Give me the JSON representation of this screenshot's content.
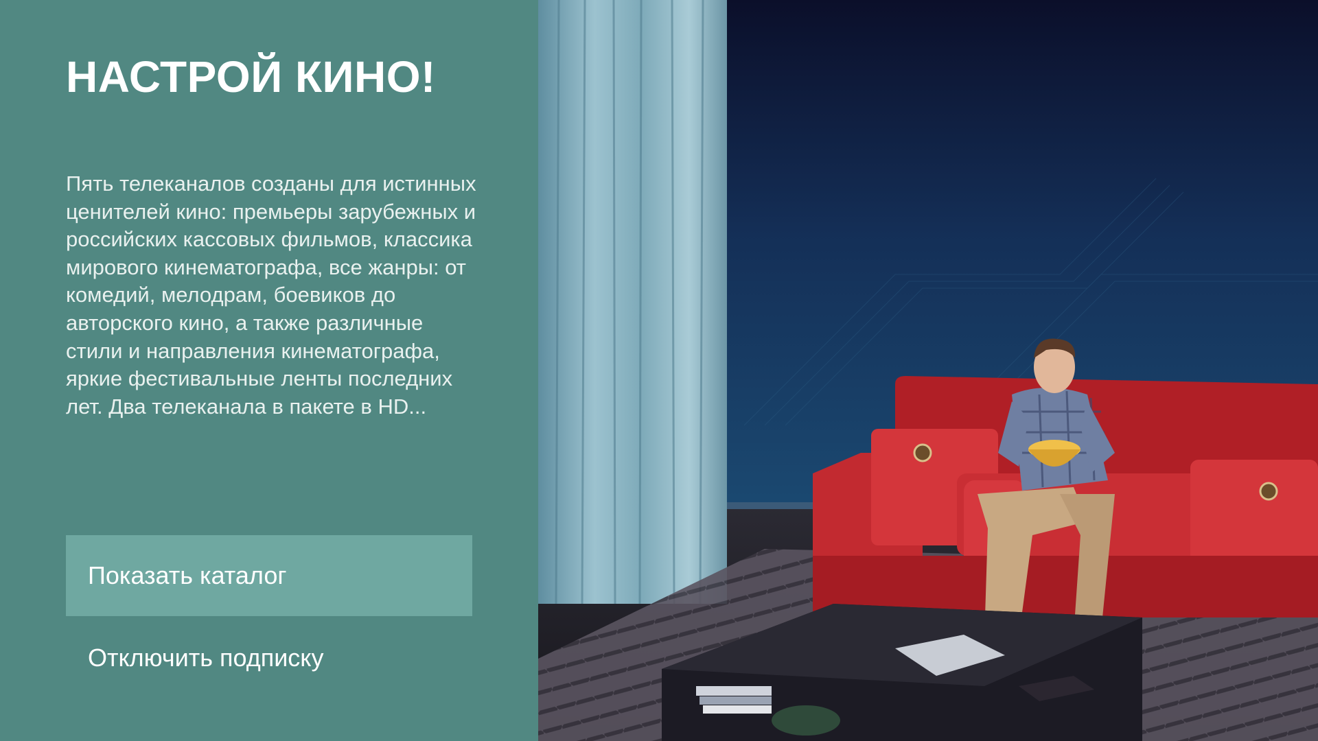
{
  "promo": {
    "title": "НАСТРОЙ КИНО!",
    "description": "Пять телеканалов созданы для истинных ценителей кино: премьеры зарубежных и российских кассовых фильмов, классика мирового кинематографа, все жанры: от комедий, мелодрам, боевиков до авторского кино, а также различные стили и направления кинематографа, яркие фестивальные ленты последних лет. Два телеканала в пакете в HD...",
    "primary_button": "Показать каталог",
    "secondary_button": "Отключить подписку"
  },
  "colors": {
    "panel_bg": "#518882",
    "primary_button_bg": "#6fa8a1",
    "text": "#ffffff"
  },
  "hero_image": {
    "subject": "man-with-popcorn-on-red-sofa"
  }
}
